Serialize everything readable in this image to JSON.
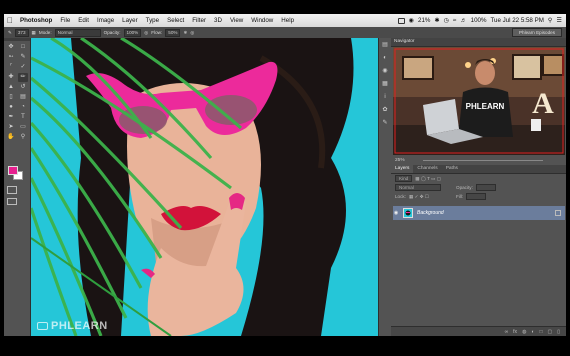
{
  "menubar": {
    "apple": "",
    "items": [
      "Photoshop",
      "File",
      "Edit",
      "Image",
      "Layer",
      "Type",
      "Select",
      "Filter",
      "3D",
      "View",
      "Window",
      "Help"
    ],
    "status": {
      "battery": "21%",
      "volume": "100%",
      "datetime": "Tue Jul 22  5:58 PM"
    }
  },
  "options": {
    "mode_label": "Mode:",
    "mode_value": "Normal",
    "opacity_label": "Opacity:",
    "opacity_value": "100%",
    "flow_label": "Flow:",
    "flow_value": "50%",
    "brush_size": "373",
    "workspace": "Phlearn Episodes"
  },
  "colors": {
    "foreground": "#e6208f",
    "background": "#ffffff",
    "canvas_bg": "#25c6d8"
  },
  "tools": [
    "move-tool",
    "marquee-tool",
    "lasso-tool",
    "quick-select-tool",
    "crop-tool",
    "eyedropper-tool",
    "healing-tool",
    "brush-tool",
    "stamp-tool",
    "history-brush-tool",
    "eraser-tool",
    "gradient-tool",
    "blur-tool",
    "dodge-tool",
    "pen-tool",
    "type-tool",
    "path-select-tool",
    "shape-tool",
    "hand-tool",
    "zoom-tool"
  ],
  "navigator": {
    "title": "Navigator",
    "zoom": "25%",
    "thumb_text": "PHLEARN",
    "thumb_letter": "A"
  },
  "layers_panel": {
    "tabs": [
      "Layers",
      "Channels",
      "Paths"
    ],
    "kind": "Kind",
    "blend": "Normal",
    "opacity_label": "Opacity:",
    "lock_label": "Lock:",
    "fill_label": "Fill:",
    "layer_name": "Background"
  },
  "watermark": "PHLEARN"
}
